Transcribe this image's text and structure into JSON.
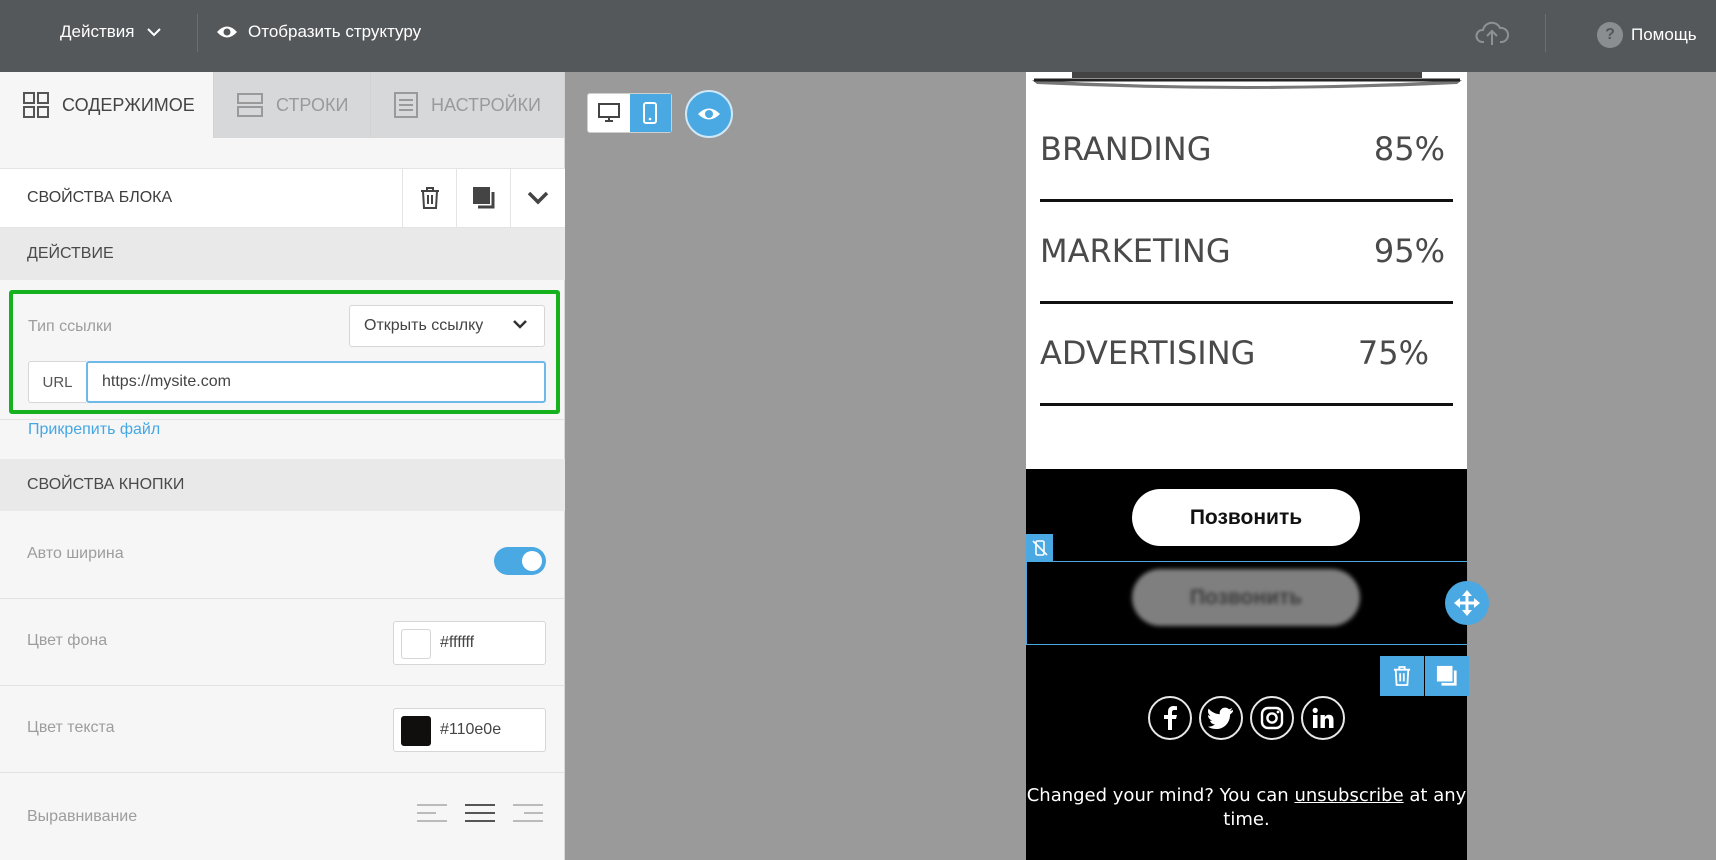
{
  "topbar": {
    "actions_label": "Действия",
    "structure_label": "Отобразить структуру",
    "help_label": "Помощь"
  },
  "tabs": [
    {
      "label": "СОДЕРЖИМОЕ",
      "icon": "grid-icon",
      "active": true
    },
    {
      "label": "СТРОКИ",
      "icon": "rows-icon",
      "active": false
    },
    {
      "label": "НАСТРОЙКИ",
      "icon": "settings-doc-icon",
      "active": false
    }
  ],
  "block": {
    "title": "СВОЙСТВА БЛОКА"
  },
  "action_section": {
    "title": "ДЕЙСТВИЕ",
    "link_type_label": "Тип ссылки",
    "link_type_value": "Открыть ссылку",
    "url_label": "URL",
    "url_value": "https://mysite.com",
    "attach_label": "Прикрепить файл"
  },
  "button_section": {
    "title": "СВОЙСТВА КНОПКИ",
    "auto_width_label": "Авто ширина",
    "auto_width_on": true,
    "bg_color_label": "Цвет фона",
    "bg_color_value": "#ffffff",
    "text_color_label": "Цвет текста",
    "text_color_value": "#110e0e",
    "align_label": "Выравнивание"
  },
  "email": {
    "skills": [
      {
        "name": "BRANDING",
        "percent": "85%"
      },
      {
        "name": "MARKETING",
        "percent": "95%"
      },
      {
        "name": "ADVERTISING",
        "percent": "75%"
      }
    ],
    "call_button_label": "Позвонить",
    "call_button_hidden_label": "Позвонить",
    "footer_before": "Changed your mind? You can ",
    "footer_link": "unsubscribe",
    "footer_after": " at any time."
  },
  "colors": {
    "accent": "#4aa8e3",
    "highlight": "#16b21d",
    "topbar": "#55585b"
  }
}
